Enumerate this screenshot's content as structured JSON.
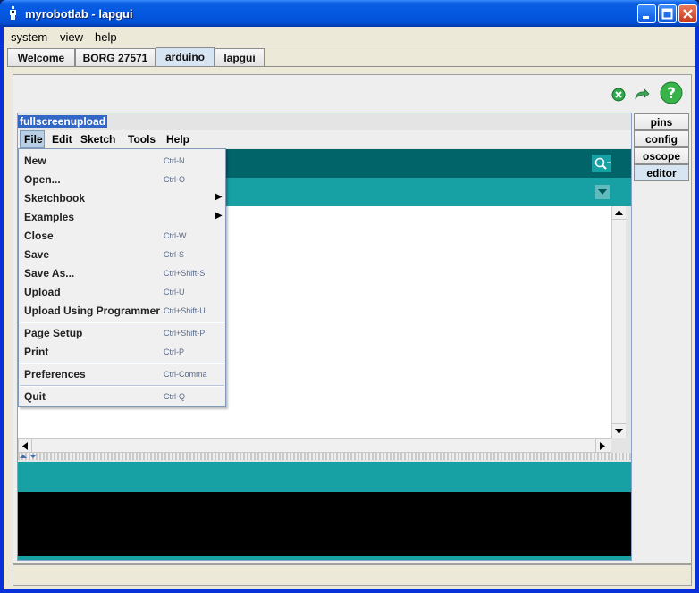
{
  "window": {
    "title": "myrobotlab - lapgui"
  },
  "menubar": [
    "system",
    "view",
    "help"
  ],
  "top_tabs": [
    "Welcome",
    "BORG 27571",
    "arduino",
    "lapgui"
  ],
  "active_top_tab": "arduino",
  "inner_frame_title": "fullscreenupload",
  "arduino_menu": [
    "File",
    "Edit",
    "Sketch",
    "Tools",
    "Help"
  ],
  "side_tabs": [
    "pins",
    "config",
    "oscope",
    "editor"
  ],
  "active_side_tab": "editor",
  "file_menu": {
    "items": [
      {
        "label": "New",
        "shortcut": "Ctrl-N"
      },
      {
        "label": "Open...",
        "shortcut": "Ctrl-O"
      },
      {
        "label": "Sketchbook",
        "submenu": true
      },
      {
        "label": "Examples",
        "submenu": true
      },
      {
        "label": "Close",
        "shortcut": "Ctrl-W"
      },
      {
        "label": "Save",
        "shortcut": "Ctrl-S"
      },
      {
        "label": "Save As...",
        "shortcut": "Ctrl+Shift-S"
      },
      {
        "label": "Upload",
        "shortcut": "Ctrl-U"
      },
      {
        "label": "Upload Using Programmer",
        "shortcut": "Ctrl+Shift-U"
      },
      {
        "label": "Page Setup",
        "shortcut": "Ctrl+Shift-P"
      },
      {
        "label": "Print",
        "shortcut": "Ctrl-P"
      },
      {
        "label": "Preferences",
        "shortcut": "Ctrl-Comma"
      },
      {
        "label": "Quit",
        "shortcut": "Ctrl-Q"
      }
    ]
  },
  "colors": {
    "arduino_dark": "#006468",
    "arduino_teal": "#17a1a5",
    "console": "#000000",
    "titlebar": "#0458e0"
  }
}
